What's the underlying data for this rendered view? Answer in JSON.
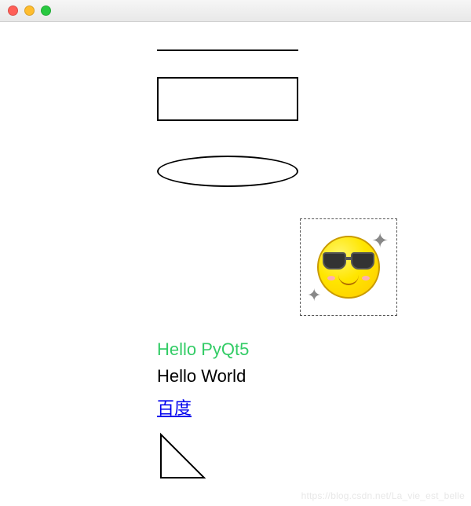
{
  "titlebar": {
    "close": "close",
    "minimize": "minimize",
    "maximize": "maximize"
  },
  "shapes": {
    "line": "horizontal-line",
    "rectangle": "rectangle",
    "ellipse": "ellipse",
    "triangle": "right-triangle"
  },
  "pixmap": {
    "description": "cool-sunglasses-emoji",
    "sparkle_glyph": "✦"
  },
  "texts": {
    "colored": "Hello PyQt5",
    "plain": "Hello World",
    "link": "百度"
  },
  "colors": {
    "colored_text": "#33cc66",
    "link": "#0000ee"
  },
  "watermark": "https://blog.csdn.net/La_vie_est_belle"
}
